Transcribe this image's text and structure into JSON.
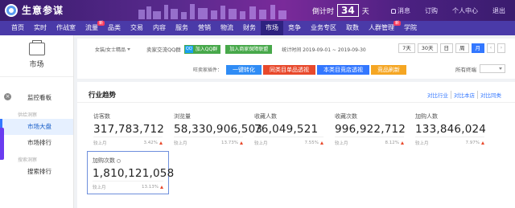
{
  "app": {
    "title": "生意参谋"
  },
  "top": {
    "countdown_prefix": "倒计时",
    "countdown_days": "34",
    "countdown_suffix": "天",
    "links": [
      "消息",
      "订购",
      "个人中心",
      "退出"
    ]
  },
  "nav": {
    "items": [
      "首页",
      "实时",
      "作战室",
      "流量",
      "品类",
      "交易",
      "内容",
      "服务",
      "营销",
      "物流",
      "财务",
      "市场",
      "竞争",
      "业务专区",
      "取数",
      "人群管理",
      "学院"
    ],
    "badges": {
      "流量": "新",
      "人群管理": "新"
    },
    "active": "市场"
  },
  "sidebar": {
    "head": "市场",
    "sections": [
      {
        "title": "",
        "items": [
          "监控看板"
        ]
      },
      {
        "title": "供给洞察",
        "items": [
          "市场大盘",
          "市场排行"
        ]
      },
      {
        "title": "搜索洞察",
        "items": [
          "搜索排行"
        ]
      }
    ],
    "active": "市场大盘"
  },
  "filters": {
    "category": "女装/女士精品",
    "qq_label": "卖家交流QQ群",
    "qq_button": "加入QQ群",
    "merchant_button": "加入商家保障联盟",
    "date_range": "统计时间 2019-09-01 ~ 2019-09-30",
    "date_tabs": [
      "7天",
      "30天",
      "日",
      "周",
      "月"
    ],
    "active_date_tab": "月",
    "plugin_label": "旺卖家插件：",
    "plugins": [
      {
        "label": "一键转化",
        "color": "#2f8cf5"
      },
      {
        "label": "同类目单品透视",
        "color": "#e8492c"
      },
      {
        "label": "本类目竞店透视",
        "color": "#3377ff"
      },
      {
        "label": "竞품刷新",
        "color": "#f5a623"
      }
    ],
    "terminal_label": "所有终端",
    "terminal_value": ""
  },
  "trend": {
    "title": "行业趋势",
    "links": [
      "对比行业",
      "对比本店",
      "对比同类"
    ],
    "metrics": [
      {
        "label": "访客数",
        "value": "317,783,712",
        "foot_label": "较上月",
        "foot_pct": "3.42%"
      },
      {
        "label": "浏览量",
        "value": "58,330,906,503",
        "foot_label": "较上月",
        "foot_pct": "13.73%"
      },
      {
        "label": "收藏人数",
        "value": "76,049,521",
        "foot_label": "较上月",
        "foot_pct": "7.55%"
      },
      {
        "label": "收藏次数",
        "value": "996,922,712",
        "foot_label": "较上月",
        "foot_pct": "8.12%"
      },
      {
        "label": "加购人数",
        "value": "133,846,024",
        "foot_label": "较上月",
        "foot_pct": "7.97%"
      },
      {
        "label": "加购次数",
        "value": "1,810,121,058",
        "foot_label": "较上月",
        "foot_pct": "13.13%"
      }
    ],
    "selected_metric": "加购次数"
  }
}
